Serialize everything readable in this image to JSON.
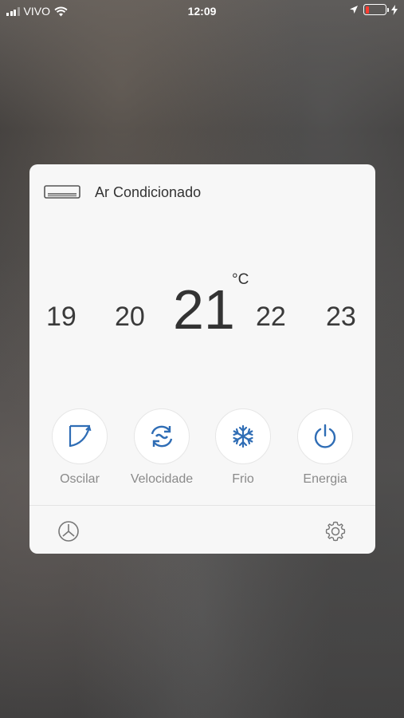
{
  "status_bar": {
    "carrier": "VIVO",
    "time": "12:09",
    "icons": [
      "signal-icon",
      "wifi-icon",
      "location-icon",
      "battery-icon",
      "charging-icon"
    ],
    "battery_color": "#ff3b30"
  },
  "card": {
    "title": "Ar Condicionado",
    "device_icon": "air-conditioner-icon",
    "temperature": {
      "options": [
        "19",
        "20",
        "21",
        "22",
        "23"
      ],
      "current": "21",
      "unit": "°C"
    },
    "controls": [
      {
        "label": "Oscilar",
        "icon": "swing-icon"
      },
      {
        "label": "Velocidade",
        "icon": "fan-speed-icon"
      },
      {
        "label": "Frio",
        "icon": "snowflake-icon"
      },
      {
        "label": "Energia",
        "icon": "power-icon"
      }
    ],
    "footer_icons": [
      "timer-icon",
      "settings-icon"
    ],
    "accent_color": "#2f6db5"
  }
}
